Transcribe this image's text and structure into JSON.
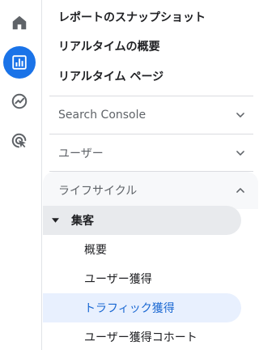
{
  "nav_rail": {
    "items": [
      {
        "icon": "home-icon",
        "active": false
      },
      {
        "icon": "reports-icon",
        "active": true
      },
      {
        "icon": "explore-icon",
        "active": false
      },
      {
        "icon": "advertising-icon",
        "active": false
      }
    ],
    "colors": {
      "active_bg": "#1a73e8",
      "icon": "#5f6368"
    }
  },
  "menu": {
    "top_items": [
      "レポートのスナップショット",
      "リアルタイムの概要",
      "リアルタイム ページ"
    ],
    "sections": [
      {
        "label": "Search Console",
        "expanded": false
      },
      {
        "label": "ユーザー",
        "expanded": false
      },
      {
        "label": "ライフサイクル",
        "expanded": true
      }
    ],
    "group": {
      "label": "集客",
      "expanded": true
    },
    "sub_items": [
      {
        "label": "概要",
        "selected": false
      },
      {
        "label": "ユーザー獲得",
        "selected": false
      },
      {
        "label": "トラフィック獲得",
        "selected": true
      },
      {
        "label": "ユーザー獲得コホート",
        "selected": false
      }
    ],
    "colors": {
      "selected_bg": "#e8f0fe",
      "selected_text": "#1967d2",
      "group_bg": "#e8eaed"
    }
  }
}
